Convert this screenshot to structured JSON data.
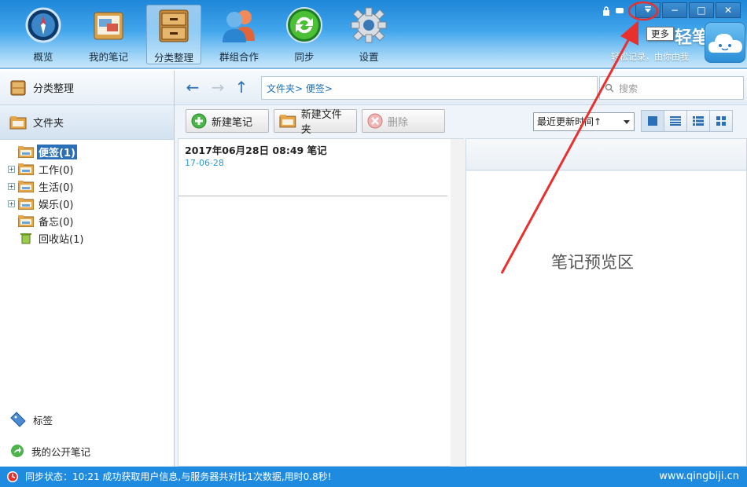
{
  "nav": {
    "items": [
      {
        "label": "概览",
        "icon": "compass-icon"
      },
      {
        "label": "我的笔记",
        "icon": "notebook-icon"
      },
      {
        "label": "分类整理",
        "icon": "cabinet-icon"
      },
      {
        "label": "群组合作",
        "icon": "group-icon"
      },
      {
        "label": "同步",
        "icon": "sync-icon"
      },
      {
        "label": "设置",
        "icon": "gear-icon"
      }
    ],
    "active": "分类整理"
  },
  "window": {
    "minimize": "−",
    "maximize": "□",
    "close": "✕"
  },
  "tooltip": "更多",
  "brand": {
    "name": "轻笔记",
    "slogan": "轻松记录，由你由我"
  },
  "sidebar": {
    "header": "分类整理",
    "folders_label": "文件夹",
    "tree": [
      {
        "label": "便签(1)",
        "selected": true,
        "expandable": false
      },
      {
        "label": "工作(0)",
        "selected": false,
        "expandable": true
      },
      {
        "label": "生活(0)",
        "selected": false,
        "expandable": true
      },
      {
        "label": "娱乐(0)",
        "selected": false,
        "expandable": true
      },
      {
        "label": "备忘(0)",
        "selected": false,
        "expandable": false
      },
      {
        "label": "回收站(1)",
        "selected": false,
        "expandable": false
      }
    ],
    "tags_label": "标签",
    "public_label": "我的公开笔记"
  },
  "pathbar": {
    "breadcrumb": "文件夹>  便签>",
    "search_placeholder": "搜索"
  },
  "toolbar": {
    "new_note": "新建笔记",
    "new_folder": "新建文件夹",
    "delete": "删除",
    "sort": "最近更新时间↑"
  },
  "notes": [
    {
      "title": "2017年06月28日 08:49 笔记",
      "date": "17-06-28"
    }
  ],
  "preview": {
    "placeholder": "笔记预览区"
  },
  "status": {
    "text": "同步状态：10:21 成功获取用户信息,与服务器共对比1次数据,用时0.8秒!",
    "site": "www.qingbiji.cn"
  },
  "colors": {
    "accent": "#1f8be0",
    "annotation": "#e8302e",
    "selected": "#2b6fb6"
  }
}
